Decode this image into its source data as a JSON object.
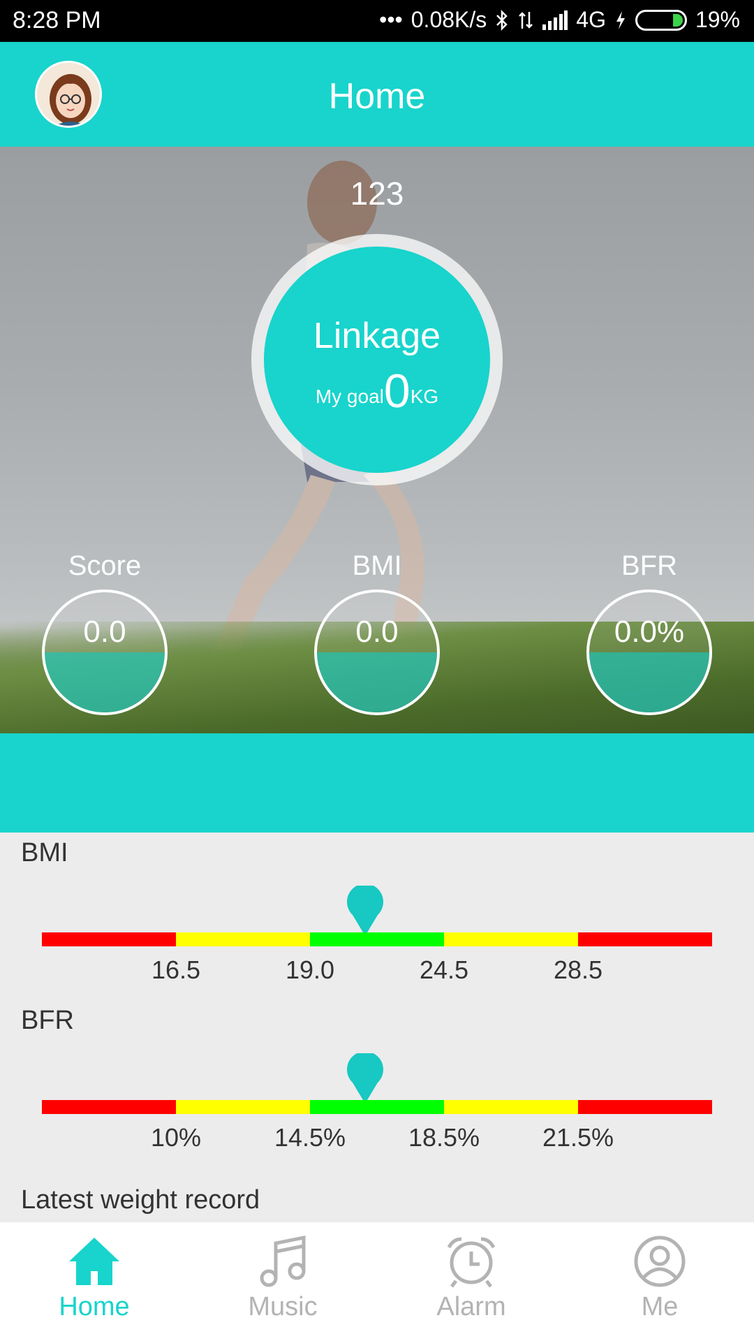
{
  "status_bar": {
    "time": "8:28 PM",
    "speed": "0.08K/s",
    "network": "4G",
    "battery": "19%"
  },
  "header": {
    "title": "Home"
  },
  "hero": {
    "top_value": "123",
    "ring_label": "Linkage",
    "goal_prefix": "My goal",
    "goal_value": "0",
    "goal_unit": "KG",
    "metrics": [
      {
        "label": "Score",
        "value": "0.0"
      },
      {
        "label": "BMI",
        "value": "0.0"
      },
      {
        "label": "BFR",
        "value": "0.0%"
      }
    ]
  },
  "bmi_scale": {
    "label": "BMI",
    "ticks": [
      "16.5",
      "19.0",
      "24.5",
      "28.5"
    ],
    "marker_fraction": 0.482
  },
  "bfr_scale": {
    "label": "BFR",
    "ticks": [
      "10%",
      "14.5%",
      "18.5%",
      "21.5%"
    ],
    "marker_fraction": 0.482
  },
  "latest": {
    "label": "Latest weight record"
  },
  "nav": {
    "items": [
      {
        "label": "Home",
        "icon": "home-icon",
        "active": true
      },
      {
        "label": "Music",
        "icon": "music-icon",
        "active": false
      },
      {
        "label": "Alarm",
        "icon": "alarm-icon",
        "active": false
      },
      {
        "label": "Me",
        "icon": "person-icon",
        "active": false
      }
    ]
  },
  "colors": {
    "accent": "#18d4cc",
    "scale_red": "#ff0000",
    "scale_yellow": "#ffff00",
    "scale_green": "#00ff00"
  }
}
